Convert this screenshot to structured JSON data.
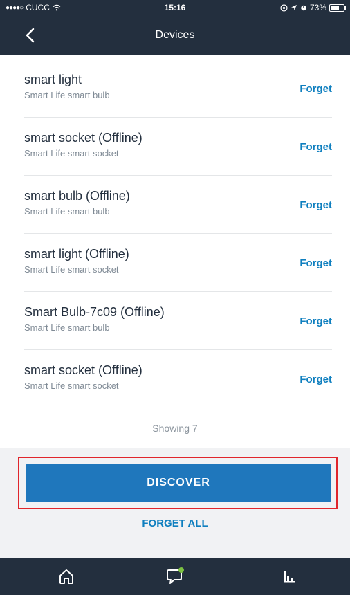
{
  "status_bar": {
    "carrier": "CUCC",
    "time": "15:16",
    "battery": "73%",
    "battery_level": 0.73
  },
  "nav": {
    "title": "Devices"
  },
  "devices": [
    {
      "name": "smart light",
      "subtitle": "Smart Life smart bulb",
      "action": "Forget"
    },
    {
      "name": "smart socket (Offline)",
      "subtitle": "Smart Life smart socket",
      "action": "Forget"
    },
    {
      "name": "smart bulb (Offline)",
      "subtitle": "Smart Life smart bulb",
      "action": "Forget"
    },
    {
      "name": "smart light (Offline)",
      "subtitle": "Smart Life smart socket",
      "action": "Forget"
    },
    {
      "name": "Smart Bulb-7c09 (Offline)",
      "subtitle": "Smart Life smart bulb",
      "action": "Forget"
    },
    {
      "name": "smart socket (Offline)",
      "subtitle": "Smart Life smart socket",
      "action": "Forget"
    }
  ],
  "showing_label": "Showing 7",
  "actions": {
    "discover": "DISCOVER",
    "forget_all": "FORGET ALL"
  },
  "tabs": [
    {
      "icon": "home-icon"
    },
    {
      "icon": "chat-icon"
    },
    {
      "icon": "activity-icon"
    }
  ],
  "colors": {
    "header": "#232f3e",
    "accent": "#1f77bc",
    "link": "#0f7fbf",
    "highlight": "#e0262c",
    "notification_dot": "#7cc242"
  }
}
